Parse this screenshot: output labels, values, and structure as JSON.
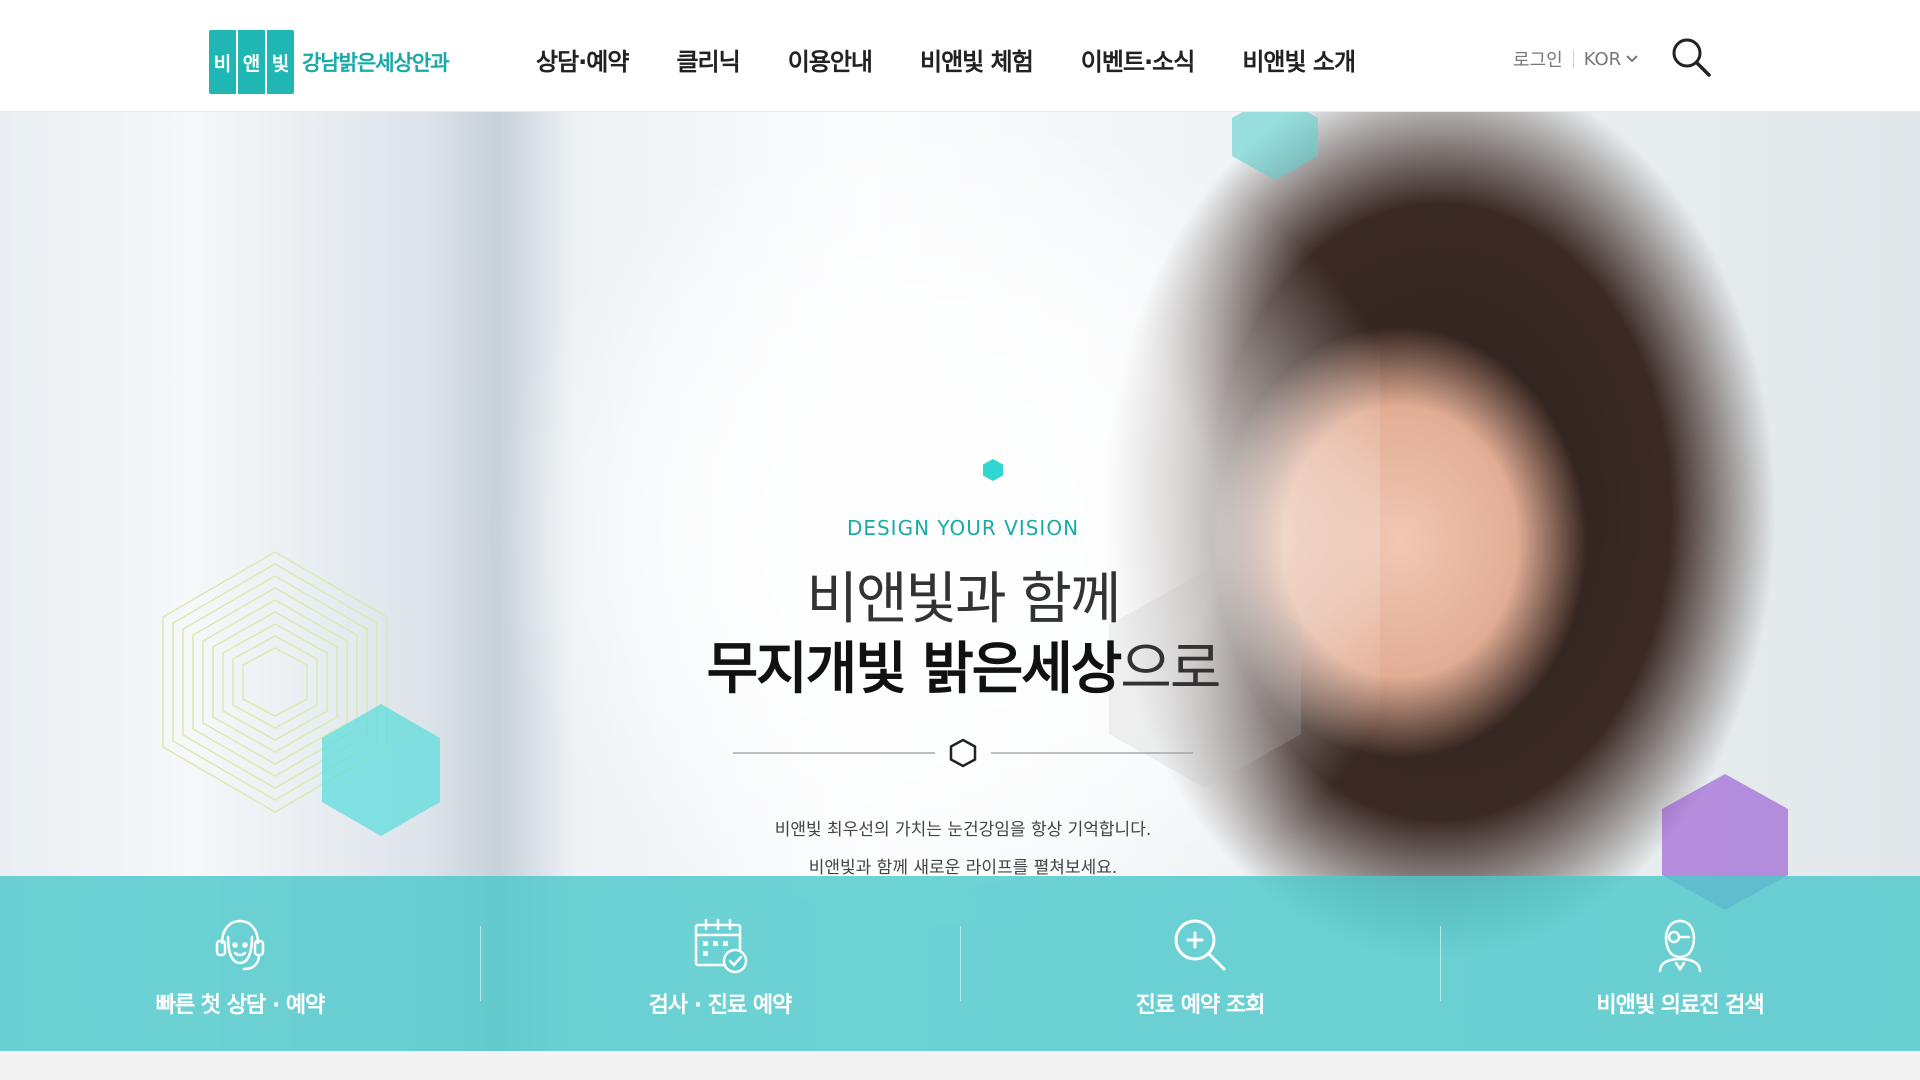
{
  "header": {
    "logo_chars": [
      "비",
      "앤",
      "빛"
    ],
    "logo_text": "강남밝은세상안과",
    "nav": [
      "상담·예약",
      "클리닉",
      "이용안내",
      "비앤빛 체험",
      "이벤트·소식",
      "비앤빛 소개"
    ],
    "login": "로그인",
    "language": "KOR",
    "icons": {
      "search": "search-icon",
      "language": "chevron-down-icon"
    }
  },
  "hero": {
    "kicker": "DESIGN YOUR VISION",
    "headline_line1": "비앤빛과 함께",
    "headline_bold": "무지개빛 밝은세상",
    "headline_light": "으로",
    "sub_line1": "비앤빛 최우선의 가치는 눈건강임을 항상 기억합니다.",
    "sub_line2": "비앤빛과 함께 새로운 라이프를 펼쳐보세요.",
    "slides": {
      "count": 3,
      "active": 3
    }
  },
  "quick_menu": [
    {
      "label": "빠른 첫 상담 · 예약",
      "icon": "headset-icon"
    },
    {
      "label": "검사 · 진료 예약",
      "icon": "calendar-check-icon"
    },
    {
      "label": "진료 예약 조회",
      "icon": "magnifier-plus-icon"
    },
    {
      "label": "비앤빛 의료진 검색",
      "icon": "doctor-icon"
    }
  ],
  "colors": {
    "accent": "#1fb6b3",
    "accent_text": "#19aaa8",
    "quick_bar": "#4dc8ca"
  }
}
